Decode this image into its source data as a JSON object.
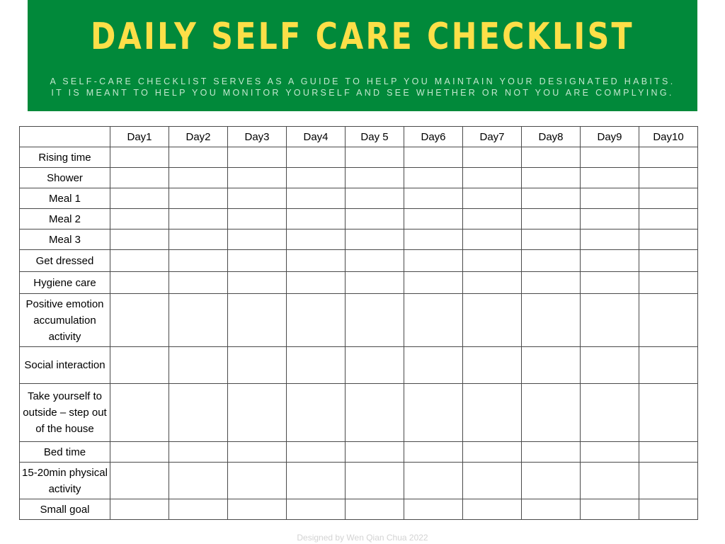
{
  "header": {
    "title": "DAILY SELF CARE CHECKLIST",
    "subtitle_line1": "A self-care checklist serves as a guide to help you maintain your designated habits.",
    "subtitle_line2": "It is meant to help you monitor yourself and see whether or not you are complying."
  },
  "table": {
    "columns": [
      "Day1",
      "Day2",
      "Day3",
      "Day4",
      "Day 5",
      "Day6",
      "Day7",
      "Day8",
      "Day9",
      "Day10"
    ],
    "rows": [
      "Rising time",
      "Shower",
      "Meal 1",
      "Meal 2",
      "Meal 3",
      "Get dressed",
      "Hygiene care",
      "Positive emotion accumulation activity",
      "Social interaction",
      "Take yourself to outside – step out of the house",
      "Bed time",
      "15-20min physical activity",
      "Small goal"
    ]
  },
  "footer": {
    "credit": "Designed by Wen Qian Chua 2022"
  },
  "colors": {
    "banner": "#01893a",
    "title": "#fddf48",
    "subtitle": "#c3e8cf",
    "grid": "#4a4a4a"
  }
}
